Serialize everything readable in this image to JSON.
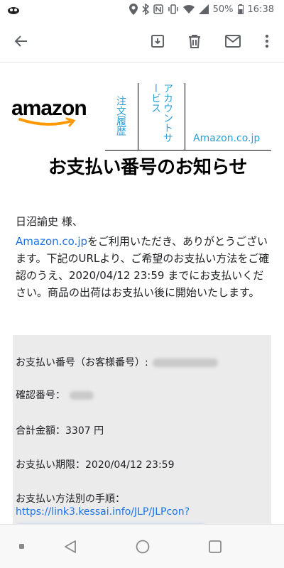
{
  "status_bar": {
    "battery": "50%",
    "time": "16:38"
  },
  "app_bar": {
    "back_icon": "arrow-back-icon",
    "archive_icon": "archive-icon",
    "delete_icon": "trash-icon",
    "mail_icon": "mail-icon",
    "more_icon": "more-vert-icon"
  },
  "email": {
    "logo_text": "amazon",
    "nav": {
      "orders": "注文履歴",
      "account": "アカウントサービス",
      "domain": "Amazon.co.jp"
    },
    "title": "お支払い番号のお知らせ",
    "greeting": "日沼諭史 様、",
    "intro_link": "Amazon.co.jp",
    "intro_text": "をご利用いただき、ありがとうございます。下記のURLより、ご希望のお支払い方法をご確認のうえ、2020/04/12 23:59 までにお支払いください。商品の出荷はお支払い後に開始いたします。",
    "payment_number_label": "お支払い番号（お客様番号）:",
    "confirmation_number_label": "確認番号：",
    "total_label": "合計金額：3307 円",
    "deadline_label": "お支払い期限：2020/04/12 23:59",
    "procedure_label": "お支払い方法別の手順：",
    "procedure_link": "https://link3.kessai.info/JLP/JLPcon?"
  },
  "colors": {
    "link": "#1a73e8",
    "nav_link": "#2a9fd6",
    "info_bg": "#ebebeb",
    "amazon_orange": "#ff9900"
  }
}
